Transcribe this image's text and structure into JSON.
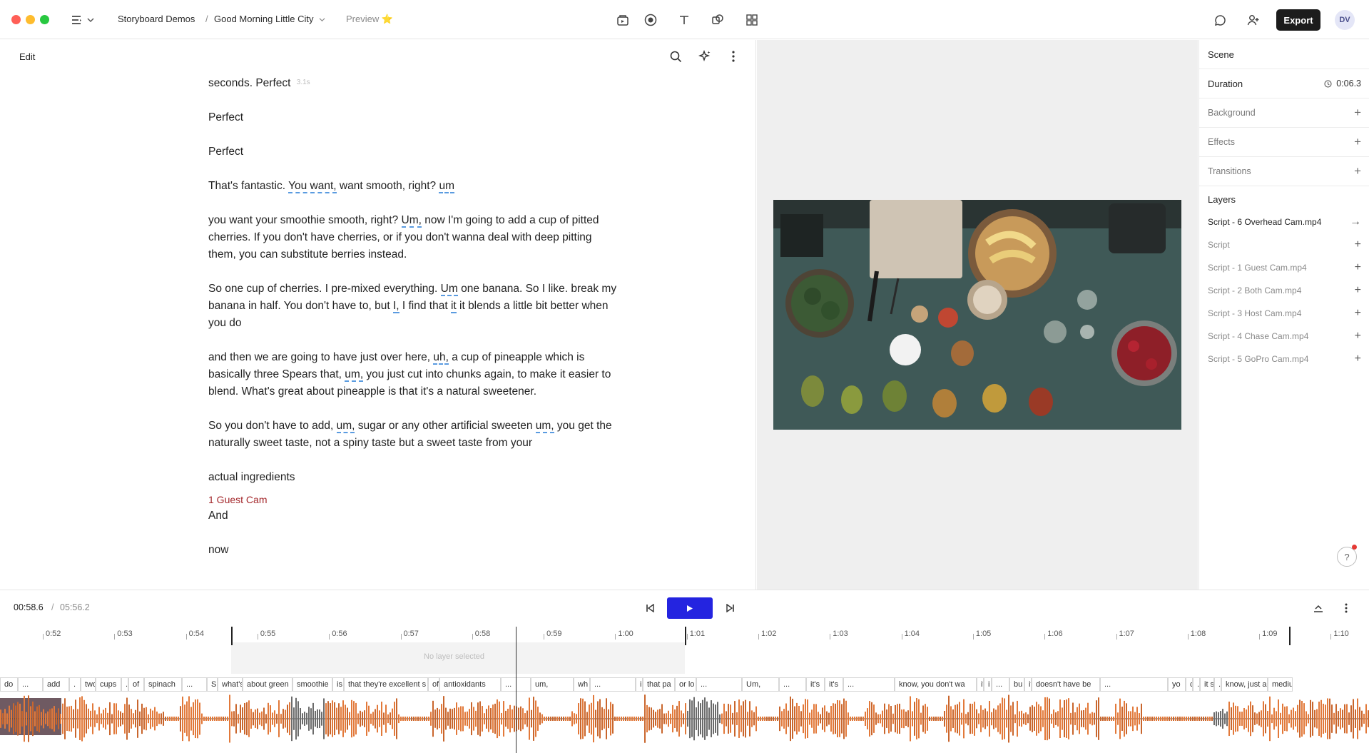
{
  "titlebar": {
    "project": "Storyboard Demos",
    "separator": "/",
    "composition": "Good Morning Little City",
    "preview_label": "Preview",
    "preview_emoji": "⭐",
    "export_label": "Export",
    "avatar_initials": "DV"
  },
  "editor": {
    "mode_label": "Edit",
    "paragraphs": [
      [
        {
          "t": "seconds. Perfect "
        },
        {
          "t": "3.1s",
          "ts": true
        }
      ],
      [
        {
          "t": "Perfect"
        }
      ],
      [
        {
          "t": "Perfect"
        }
      ],
      [
        {
          "t": "That's fantastic. "
        },
        {
          "t": "You want,",
          "f": true
        },
        {
          "t": " want smooth, right? "
        },
        {
          "t": "um",
          "f": true
        }
      ],
      [
        {
          "t": "you want your smoothie smooth, right? "
        },
        {
          "t": "Um,",
          "f": true
        },
        {
          "t": " now I'm going to add a cup of pitted cherries. If you don't have cherries, or if you don't wanna deal with deep pitting them, you can substitute berries instead."
        }
      ],
      [
        {
          "t": "So one cup of cherries. I pre-mixed everything. "
        },
        {
          "t": "Um",
          "f": true
        },
        {
          "t": " one banana. So I like. break my banana in half. You don't have to, but "
        },
        {
          "t": "I,",
          "f": true
        },
        {
          "t": " I find that "
        },
        {
          "t": "it",
          "f": true
        },
        {
          "t": " it blends a little bit better when you do"
        }
      ],
      [
        {
          "t": "and then we are going to have just over here, "
        },
        {
          "t": "uh,",
          "f": true
        },
        {
          "t": " a cup of pineapple which is basically three Spears that, "
        },
        {
          "t": "um,",
          "f": true
        },
        {
          "t": " you just cut into chunks again, to make it easier to blend. What's great about pineapple is that it's a natural sweetener."
        }
      ],
      [
        {
          "t": "So you don't have to add, "
        },
        {
          "t": "um,",
          "f": true
        },
        {
          "t": " sugar or any other artificial sweeten "
        },
        {
          "t": "um,",
          "f": true
        },
        {
          "t": " you get the naturally sweet taste, not a spiny taste but a sweet taste from your"
        }
      ],
      [
        {
          "t": "actual ingredients"
        }
      ]
    ],
    "speaker": "1 Guest Cam",
    "after_speaker": [
      "And",
      "now"
    ]
  },
  "inspector": {
    "scene_label": "Scene",
    "duration_label": "Duration",
    "duration_value": "0:06.3",
    "background_label": "Background",
    "effects_label": "Effects",
    "transitions_label": "Transitions",
    "layers_label": "Layers",
    "layers": [
      {
        "name": "Script - 6 Overhead Cam.mp4",
        "action": "→",
        "active": true
      },
      {
        "name": "Script",
        "action": "+",
        "active": false
      },
      {
        "name": "Script - 1 Guest Cam.mp4",
        "action": "+",
        "active": false
      },
      {
        "name": "Script - 2 Both Cam.mp4",
        "action": "+",
        "active": false
      },
      {
        "name": "Script - 3 Host Cam.mp4",
        "action": "+",
        "active": false
      },
      {
        "name": "Script - 4 Chase Cam.mp4",
        "action": "+",
        "active": false
      },
      {
        "name": "Script - 5 GoPro Cam.mp4",
        "action": "+",
        "active": false
      }
    ],
    "help_label": "?"
  },
  "transport": {
    "current_time": "00:58.6",
    "separator": "/",
    "total_time": "05:56.2"
  },
  "timeline": {
    "no_layer_text": "No layer selected",
    "ticks": [
      "0:52",
      "0:53",
      "0:54",
      "0:55",
      "0:56",
      "0:57",
      "0:58",
      "0:59",
      "1:00",
      "1:01",
      "1:02",
      "1:03",
      "1:04",
      "1:05",
      "1:06",
      "1:07",
      "1:08",
      "1:09",
      "1:10"
    ],
    "words": [
      "do",
      "...",
      "add",
      ".",
      "two",
      "cups",
      ".",
      "of",
      "spinach",
      "...",
      "S",
      "what's",
      "about green",
      "smoothie",
      "is",
      "that they're excellent s",
      "of",
      "antioxidants",
      "...",
      "um,",
      "wh",
      "...",
      "i",
      "that pa",
      "or lo",
      "...",
      "Um,",
      "...",
      "it's",
      "it's",
      "...",
      "know, you don't wa",
      "it",
      "i",
      "...",
      "bu",
      "it",
      "doesn't have be",
      "...",
      "yo",
      "c",
      ".",
      "it s",
      ".",
      "know, just a",
      "mediur"
    ]
  },
  "colors": {
    "accent_play": "#2424e0",
    "speaker": "#a3262a",
    "filler_underline": "#5a9be0",
    "wave_orange": "#e2793a",
    "wave_gray": "#6b6b6b"
  }
}
